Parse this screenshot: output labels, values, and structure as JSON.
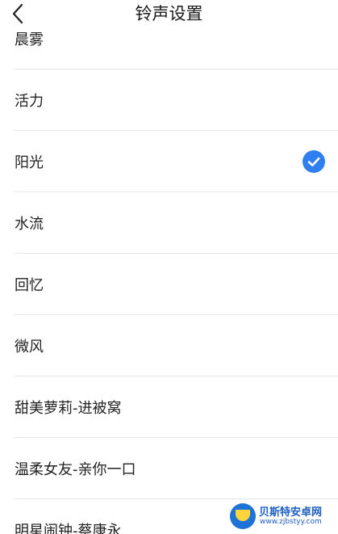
{
  "header": {
    "title": "铃声设置",
    "back_icon": "chevron-left-icon"
  },
  "ringtones": [
    {
      "label": "晨雾",
      "selected": false
    },
    {
      "label": "活力",
      "selected": false
    },
    {
      "label": "阳光",
      "selected": true
    },
    {
      "label": "水流",
      "selected": false
    },
    {
      "label": "回忆",
      "selected": false
    },
    {
      "label": "微风",
      "selected": false
    },
    {
      "label": "甜美萝莉-进被窝",
      "selected": false
    },
    {
      "label": "温柔女友-亲你一口",
      "selected": false
    },
    {
      "label": "明星闹钟-蔡康永",
      "selected": false
    }
  ],
  "colors": {
    "accent": "#2f7ff0",
    "divider": "#e6e6e6",
    "text": "#222222"
  },
  "watermark": {
    "title": "贝斯特安卓网",
    "url": "www.zjbstyy.com"
  }
}
